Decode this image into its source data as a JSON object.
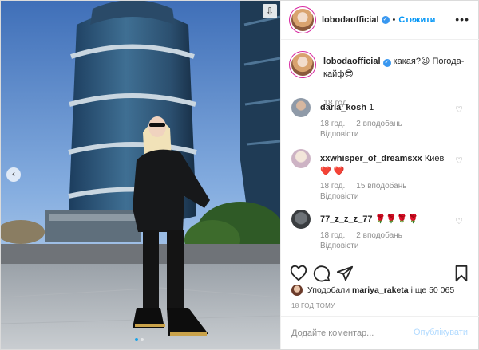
{
  "post": {
    "author": "lobodaofficial",
    "separator": "•",
    "follow_label": "Стежити",
    "more_icon": "more-dots-icon",
    "caption": "какая?😉 Погода-кайф😎",
    "caption_time": "18 год.",
    "comments": [
      {
        "user": "daria_kosh",
        "text": "1",
        "time": "18 год.",
        "likes": "",
        "reply": "Відповісти"
      },
      {
        "user": "xxwhisper_of_dreamsxx",
        "text": "Киев",
        "hearts": "❤️ ❤️",
        "time": "18 год.",
        "likes": "15 вподобань",
        "reply": "Відповісти"
      },
      {
        "user": "77_z_z_z_77",
        "text": "",
        "roses": "🌹🌹🌹🌹",
        "time": "18 год.",
        "likes": "2 вподобань",
        "reply": "Відповісти"
      }
    ],
    "comment0_extra": {
      "time": "18 год.",
      "likes": "2 вподобань",
      "reply": "Відповісти"
    },
    "liked_by_prefix": "Уподобали",
    "liked_by_user": "mariya_raketa",
    "liked_by_suffix": "і ще 50 065",
    "time_ago": "18 ГОД ТОМУ",
    "comment_placeholder": "Додайте коментар...",
    "publish_label": "Опублікувати"
  },
  "colors": {
    "accent": "#0095f6",
    "text": "#262626",
    "muted": "#8e8e8e",
    "border": "#efefef"
  }
}
